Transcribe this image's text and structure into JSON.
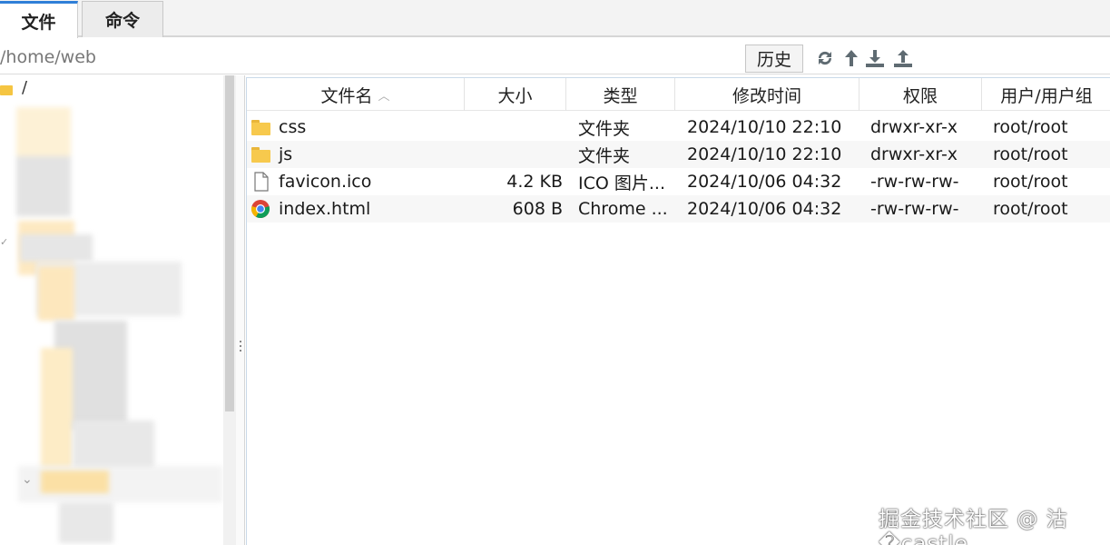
{
  "tabs": [
    {
      "label": "文件",
      "active": true
    },
    {
      "label": "命令",
      "active": false
    }
  ],
  "path": {
    "value": "/home/web"
  },
  "toolbar": {
    "history_label": "历史",
    "icons": [
      "refresh-icon",
      "up-arrow-icon",
      "download-icon",
      "upload-icon"
    ]
  },
  "tree": {
    "root_label": "/"
  },
  "table": {
    "columns": [
      "文件名",
      "大小",
      "类型",
      "修改时间",
      "权限",
      "用户/用户组"
    ],
    "sort_indicator": "^",
    "rows": [
      {
        "icon": "folder-icon",
        "name": "css",
        "size": "",
        "type": "文件夹",
        "modified": "2024/10/10 22:10",
        "permissions": "drwxr-xr-x",
        "owner": "root/root"
      },
      {
        "icon": "folder-icon",
        "name": "js",
        "size": "",
        "type": "文件夹",
        "modified": "2024/10/10 22:10",
        "permissions": "drwxr-xr-x",
        "owner": "root/root"
      },
      {
        "icon": "file-icon",
        "name": "favicon.ico",
        "size": "4.2 KB",
        "type": "ICO 图片...",
        "modified": "2024/10/06 04:32",
        "permissions": "-rw-rw-rw-",
        "owner": "root/root"
      },
      {
        "icon": "chrome-icon",
        "name": "index.html",
        "size": "608 B",
        "type": "Chrome ...",
        "modified": "2024/10/06 04:32",
        "permissions": "-rw-rw-rw-",
        "owner": "root/root"
      }
    ]
  },
  "watermark": "掘金技术社区 @ 沽�castle",
  "colors": {
    "accent": "#2f7fd8",
    "folder": "#f7c94d"
  }
}
